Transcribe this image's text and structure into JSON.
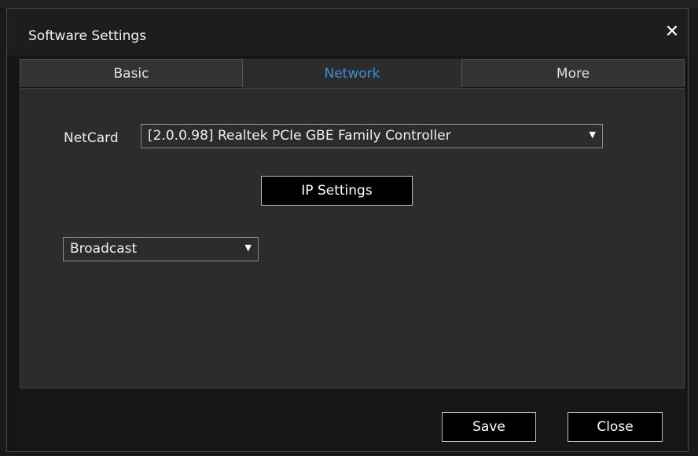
{
  "window": {
    "title": "Software Settings",
    "close_glyph": "✕"
  },
  "tabs": [
    {
      "label": "Basic",
      "active": false
    },
    {
      "label": "Network",
      "active": true
    },
    {
      "label": "More",
      "active": false
    }
  ],
  "network": {
    "netcard_label": "NetCard",
    "netcard_value": "[2.0.0.98] Realtek PCIe GBE Family Controller",
    "ip_settings_label": "IP Settings",
    "mode_value": "Broadcast"
  },
  "footer": {
    "save_label": "Save",
    "close_label": "Close"
  },
  "icons": {
    "dropdown_caret": "▼",
    "close": "close-icon"
  },
  "colors": {
    "active_tab_text": "#3a8fd8",
    "panel_bg": "#2c2c2c",
    "button_bg": "#000000"
  }
}
